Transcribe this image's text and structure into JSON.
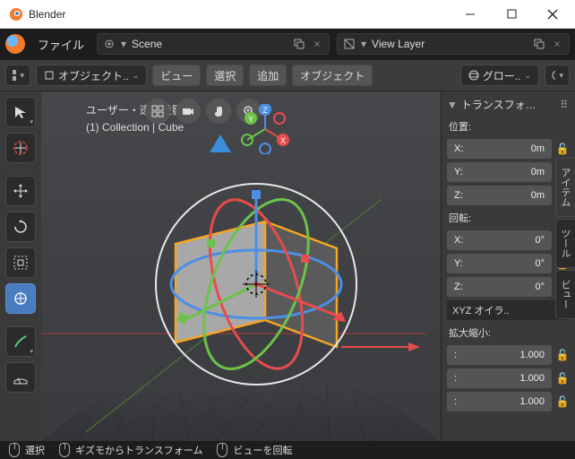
{
  "window": {
    "title": "Blender"
  },
  "topbar": {
    "file_label": "ファイル",
    "scene_field": "Scene",
    "viewlayer_field": "View Layer"
  },
  "toolbar": {
    "mode_label": "オブジェクト..",
    "view": "ビュー",
    "select": "選択",
    "add": "追加",
    "object": "オブジェクト",
    "orientation": "グロー.."
  },
  "viewport": {
    "label1": "ユーザー・透視投影",
    "label2": "(1) Collection | Cube"
  },
  "panel": {
    "header": "トランスフォ…",
    "location_label": "位置:",
    "location": [
      {
        "axis": "X",
        "value": "0m"
      },
      {
        "axis": "Y",
        "value": "0m"
      },
      {
        "axis": "Z",
        "value": "0m"
      }
    ],
    "rotation_label": "回転:",
    "rotation": [
      {
        "axis": "X",
        "value": "0°"
      },
      {
        "axis": "Y",
        "value": "0°"
      },
      {
        "axis": "Z",
        "value": "0°"
      }
    ],
    "rotation_mode": "XYZ オイラ..",
    "scale_label": "拡大縮小:",
    "scale": [
      {
        "value": "1.000"
      },
      {
        "value": "1.000"
      },
      {
        "value": "1.000"
      }
    ]
  },
  "side_tabs": {
    "item": "アイテム",
    "tool": "ツール",
    "view": "ビュー"
  },
  "statusbar": {
    "select": "選択",
    "gizmo": "ギズモからトランスフォーム",
    "rotate": "ビューを回転"
  }
}
